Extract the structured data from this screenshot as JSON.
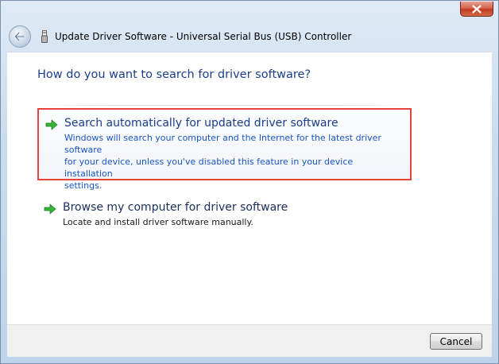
{
  "window": {
    "title": "Update Driver Software - Universal Serial Bus (USB) Controller"
  },
  "heading": "How do you want to search for driver software?",
  "options": [
    {
      "title": "Search automatically for updated driver software",
      "description_lines": [
        "Windows will search your computer and the Internet for the latest driver software",
        "for your device, unless you've disabled this feature in your device installation",
        "settings."
      ]
    },
    {
      "title": "Browse my computer for driver software",
      "description_lines": [
        "Locate and install driver software manually."
      ]
    }
  ],
  "footer": {
    "cancel_label": "Cancel"
  },
  "icons": {
    "close": "close-icon",
    "back": "back-arrow-icon",
    "title": "usb-device-icon",
    "option_arrow": "green-arrow-icon"
  },
  "colors": {
    "highlight_border": "#e8433c",
    "heading_blue": "#1a3e8a",
    "arrow_green": "#2fa82f"
  }
}
